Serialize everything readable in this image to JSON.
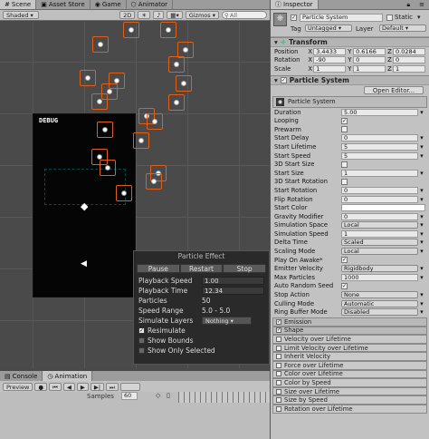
{
  "scene": {
    "tabs": [
      {
        "label": "Scene"
      },
      {
        "label": "Asset Store"
      },
      {
        "label": "Game"
      },
      {
        "label": "Animator"
      }
    ],
    "shading_mode": "Shaded",
    "mode_2d": "2D",
    "gizmos_label": "Gizmos",
    "search_placeholder": "All",
    "debug_label": "DEBUG"
  },
  "particle_effect": {
    "title": "Particle Effect",
    "pause": "Pause",
    "restart": "Restart",
    "stop": "Stop",
    "rows": [
      {
        "label": "Playback Speed",
        "value": "1.00"
      },
      {
        "label": "Playback Time",
        "value": "12.34"
      },
      {
        "label": "Particles",
        "value": "50"
      },
      {
        "label": "Speed Range",
        "value": "5.0 - 5.0"
      }
    ],
    "simulate_layers_label": "Simulate Layers",
    "simulate_layers_value": "Nothing",
    "resimulate": "Resimulate",
    "show_bounds": "Show Bounds",
    "show_only_selected": "Show Only Selected"
  },
  "bottom": {
    "tabs": [
      {
        "label": "Console"
      },
      {
        "label": "Animation"
      }
    ],
    "preview_label": "Preview",
    "samples_label": "Samples",
    "samples_value": "60"
  },
  "inspector": {
    "tab_label": "Inspector",
    "object_name": "Particle System",
    "static_label": "Static",
    "tag_label": "Tag",
    "tag_value": "Untagged",
    "layer_label": "Layer",
    "layer_value": "Default",
    "transform": {
      "title": "Transform",
      "position_label": "Position",
      "rotation_label": "Rotation",
      "scale_label": "Scale",
      "position": {
        "x": "3.4433",
        "y": "0.6166",
        "z": "0.0284"
      },
      "rotation": {
        "x": "-90",
        "y": "0",
        "z": "0"
      },
      "scale": {
        "x": "1",
        "y": "1",
        "z": "1"
      }
    },
    "particle_system": {
      "title": "Particle System",
      "open_editor": "Open Editor...",
      "subheader": "Particle System",
      "props": [
        {
          "label": "Duration",
          "value": "5.00",
          "kind": "field"
        },
        {
          "label": "Looping",
          "value": "✓",
          "kind": "check"
        },
        {
          "label": "Prewarm",
          "value": "",
          "kind": "check"
        },
        {
          "label": "Start Delay",
          "value": "0",
          "kind": "field"
        },
        {
          "label": "Start Lifetime",
          "value": "5",
          "kind": "field"
        },
        {
          "label": "Start Speed",
          "value": "5",
          "kind": "field"
        },
        {
          "label": "3D Start Size",
          "value": "",
          "kind": "check"
        },
        {
          "label": "Start Size",
          "value": "1",
          "kind": "field"
        },
        {
          "label": "3D Start Rotation",
          "value": "",
          "kind": "check"
        },
        {
          "label": "Start Rotation",
          "value": "0",
          "kind": "field"
        },
        {
          "label": "Flip Rotation",
          "value": "0",
          "kind": "field"
        },
        {
          "label": "Start Color",
          "value": "",
          "kind": "color"
        },
        {
          "label": "Gravity Modifier",
          "value": "0",
          "kind": "field"
        },
        {
          "label": "Simulation Space",
          "value": "Local",
          "kind": "drop"
        },
        {
          "label": "Simulation Speed",
          "value": "1",
          "kind": "field"
        },
        {
          "label": "Delta Time",
          "value": "Scaled",
          "kind": "drop"
        },
        {
          "label": "Scaling Mode",
          "value": "Local",
          "kind": "drop"
        },
        {
          "label": "Play On Awake*",
          "value": "✓",
          "kind": "check"
        },
        {
          "label": "Emitter Velocity",
          "value": "Rigidbody",
          "kind": "drop"
        },
        {
          "label": "Max Particles",
          "value": "1000",
          "kind": "field"
        },
        {
          "label": "Auto Random Seed",
          "value": "✓",
          "kind": "check"
        },
        {
          "label": "Stop Action",
          "value": "None",
          "kind": "drop"
        },
        {
          "label": "Culling Mode",
          "value": "Automatic",
          "kind": "drop"
        },
        {
          "label": "Ring Buffer Mode",
          "value": "Disabled",
          "kind": "drop"
        }
      ],
      "modules": [
        {
          "label": "Emission",
          "enabled": true
        },
        {
          "label": "Shape",
          "enabled": true
        },
        {
          "label": "Velocity over Lifetime",
          "enabled": false
        },
        {
          "label": "Limit Velocity over Lifetime",
          "enabled": false
        },
        {
          "label": "Inherit Velocity",
          "enabled": false
        },
        {
          "label": "Force over Lifetime",
          "enabled": false
        },
        {
          "label": "Color over Lifetime",
          "enabled": false
        },
        {
          "label": "Color by Speed",
          "enabled": false
        },
        {
          "label": "Size over Lifetime",
          "enabled": false
        },
        {
          "label": "Size by Speed",
          "enabled": false
        },
        {
          "label": "Rotation over Lifetime",
          "enabled": false
        }
      ]
    }
  },
  "colors": {
    "selection_orange": "#e0601a",
    "scene_bg": "#4a4a4a",
    "inspector_bg": "#c2c2c2"
  }
}
